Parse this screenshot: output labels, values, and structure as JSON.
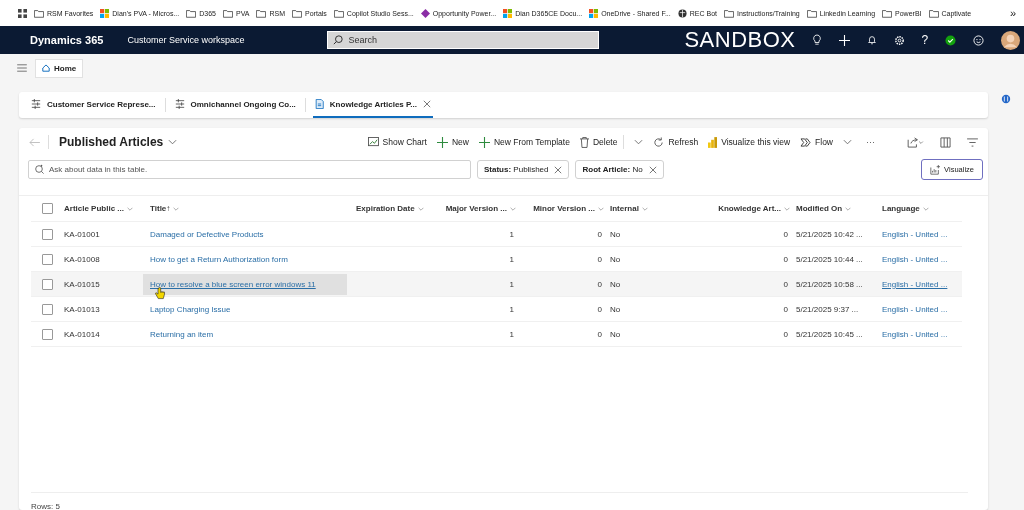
{
  "bookmarks": [
    {
      "label": "RSM Favorites",
      "kind": "folder"
    },
    {
      "label": "Dian's PVA - Micros...",
      "kind": "tiles"
    },
    {
      "label": "D365",
      "kind": "folder"
    },
    {
      "label": "PVA",
      "kind": "folder"
    },
    {
      "label": "RSM",
      "kind": "folder"
    },
    {
      "label": "Portals",
      "kind": "folder"
    },
    {
      "label": "Copilot Studio Sess...",
      "kind": "folder"
    },
    {
      "label": "Opportunity Power...",
      "kind": "diamond"
    },
    {
      "label": "Dian D365CE Docu...",
      "kind": "tiles"
    },
    {
      "label": "OneDrive - Shared F...",
      "kind": "tiles"
    },
    {
      "label": "REC Bot",
      "kind": "globe"
    },
    {
      "label": "Instructions/Training",
      "kind": "folder"
    },
    {
      "label": "Linkedin Learning",
      "kind": "folder"
    },
    {
      "label": "PowerBI",
      "kind": "folder"
    },
    {
      "label": "Captivate",
      "kind": "folder"
    }
  ],
  "bookmarks_overflow": "»",
  "app_bar": {
    "app_name": "Dynamics 365",
    "workspace": "Customer Service workspace",
    "search": {
      "placeholder": "Search"
    },
    "environment": "SANDBOX",
    "help": "?"
  },
  "home_tab": {
    "label": "Home"
  },
  "session_tabs": [
    {
      "label": "Customer Service Represe...",
      "kind": "dashboard",
      "selected": false,
      "closable": false
    },
    {
      "label": "Omnichannel Ongoing Co...",
      "kind": "dashboard",
      "selected": false,
      "closable": false
    },
    {
      "label": "Knowledge Articles P...",
      "kind": "page",
      "selected": true,
      "closable": true
    }
  ],
  "view": {
    "title": "Published Articles"
  },
  "commands": [
    {
      "label": "Show Chart",
      "kind": "chart",
      "split": false
    },
    {
      "label": "New",
      "kind": "plus",
      "split": false
    },
    {
      "label": "New From Template",
      "kind": "plus",
      "split": false
    },
    {
      "label": "Delete",
      "kind": "trash",
      "split": true
    },
    {
      "label": "Refresh",
      "kind": "refresh",
      "split": false
    },
    {
      "label": "Visualize this view",
      "kind": "powerbi",
      "split": false
    },
    {
      "label": "Flow",
      "kind": "flow",
      "split": true
    }
  ],
  "more_commands": "···",
  "ask": {
    "placeholder": "Ask about data in this table."
  },
  "filters": [
    {
      "label": "Status:",
      "value": "Published"
    },
    {
      "label": "Root Article:",
      "value": "No"
    }
  ],
  "visualize_button": {
    "label": "Visualize"
  },
  "table": {
    "select_all_checked": false,
    "columns": [
      {
        "label": "Article Public ...",
        "kind": "text"
      },
      {
        "label": "Title",
        "kind": "link",
        "sort_mark": "↑"
      },
      {
        "label": "Expiration Date",
        "kind": "text"
      },
      {
        "label": "Major Version ...",
        "kind": "number"
      },
      {
        "label": "Minor Version ...",
        "kind": "number"
      },
      {
        "label": "Internal",
        "kind": "text"
      },
      {
        "label": "Knowledge Art...",
        "kind": "number"
      },
      {
        "label": "Modified On",
        "kind": "text"
      },
      {
        "label": "Language",
        "kind": "link"
      }
    ],
    "rows": [
      {
        "checked": false,
        "highlighted": false,
        "cells": [
          "KA-01001",
          "Damaged or Defective Products",
          "",
          "1",
          "0",
          "No",
          "0",
          "5/21/2025 10:42 ...",
          "English - United ..."
        ]
      },
      {
        "checked": false,
        "highlighted": false,
        "cells": [
          "KA-01008",
          "How to get a Return Authorization form",
          "",
          "1",
          "0",
          "No",
          "0",
          "5/21/2025 10:44 ...",
          "English - United ..."
        ]
      },
      {
        "checked": false,
        "highlighted": true,
        "cells": [
          "KA-01015",
          "How to resolve a blue screen error windows 11",
          "",
          "1",
          "0",
          "No",
          "0",
          "5/21/2025 10:58 ...",
          "English - United ..."
        ]
      },
      {
        "checked": false,
        "highlighted": false,
        "cells": [
          "KA-01013",
          "Laptop Charging Issue",
          "",
          "1",
          "0",
          "No",
          "0",
          "5/21/2025 9:37 ...",
          "English - United ..."
        ]
      },
      {
        "checked": false,
        "highlighted": false,
        "cells": [
          "KA-01014",
          "Returning an item",
          "",
          "1",
          "0",
          "No",
          "0",
          "5/21/2025 10:45 ...",
          "English - United ..."
        ]
      }
    ],
    "footer": "Rows: 5"
  }
}
